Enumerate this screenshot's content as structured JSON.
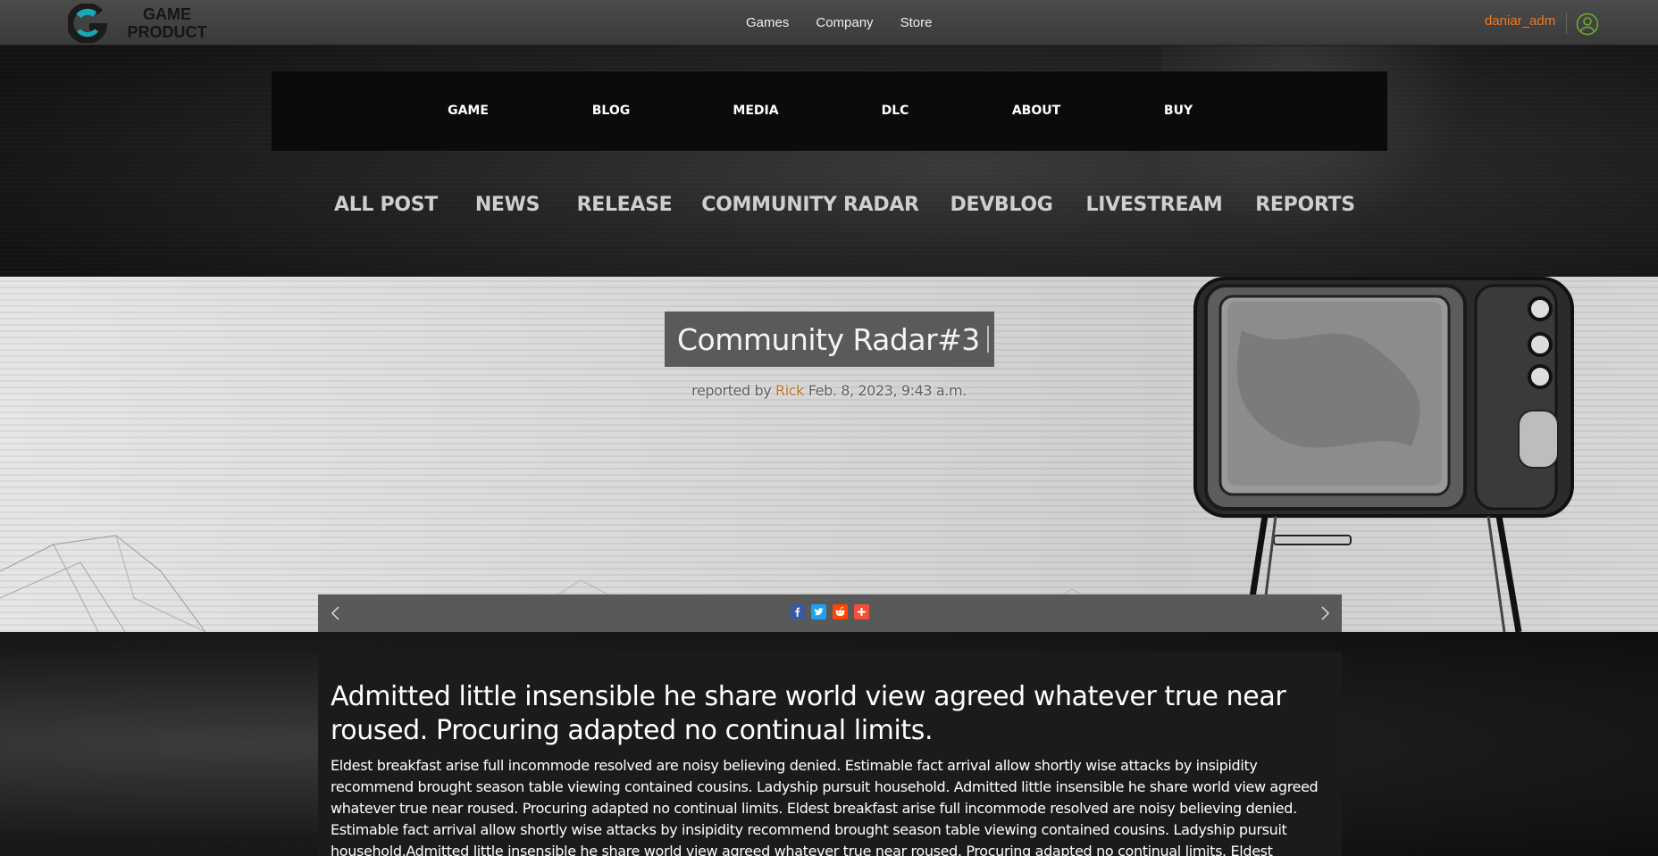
{
  "topbar": {
    "logo_text": "GAME PRODUCT",
    "nav": [
      "Games",
      "Company",
      "Store"
    ],
    "username": "daniar_adm"
  },
  "main_menu": [
    "GAME",
    "BLOG",
    "MEDIA",
    "DLC",
    "ABOUT",
    "BUY"
  ],
  "categories": [
    "ALL POST",
    "NEWS",
    "RELEASE",
    "COMMUNITY RADAR",
    "DEVBLOG",
    "LIVESTREAM",
    "REPORTS"
  ],
  "post": {
    "title": "Community Radar#3",
    "byline_prefix": "reported by",
    "author": "Rick",
    "date": "Feb. 8, 2023, 9:43 a.m."
  },
  "share": {
    "icons": [
      "facebook-icon",
      "twitter-icon",
      "reddit-icon",
      "plus-icon"
    ],
    "colors": {
      "facebook": "#3b5998",
      "twitter": "#1da1f2",
      "reddit": "#ff4500",
      "plus": "#f0503c"
    }
  },
  "article": {
    "heading": "Admitted little insensible he share world view agreed whatever true near roused. Procuring adapted no continual limits.",
    "body": "Eldest breakfast arise full incommode resolved are noisy believing denied. Estimable fact arrival allow shortly wise attacks by insipidity recommend brought season table viewing contained cousins. Ladyship pursuit household. Admitted little insensible he share world view agreed whatever true near roused. Procuring adapted no continual limits. Eldest breakfast arise full incommode resolved are noisy believing denied. Estimable fact arrival allow shortly wise attacks by insipidity recommend brought season table viewing contained cousins. Ladyship pursuit household.Admitted little insensible he share world view agreed whatever true near roused. Procuring adapted no continual limits. Eldest breakfast arise full incommode"
  },
  "colors": {
    "accent": "#f07820",
    "user_icon": "#6fae2e",
    "author": "#b8731f"
  }
}
